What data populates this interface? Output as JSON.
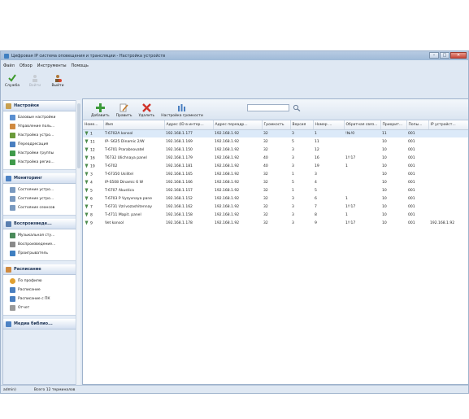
{
  "window": {
    "title": "Цифровая IP система оповещения и трансляции - Настройка устройств",
    "controls": [
      "–",
      "□",
      "✕"
    ]
  },
  "menu": [
    "Файл",
    "Обзор",
    "Инструменты",
    "Помощь"
  ],
  "main_toolbar": [
    {
      "label": "Служба",
      "icon": "service-check-icon",
      "enabled": true
    },
    {
      "label": "Войти",
      "icon": "login-icon",
      "enabled": false
    },
    {
      "label": "Выйти",
      "icon": "logout-icon",
      "enabled": true
    }
  ],
  "sidebar": {
    "groups": [
      {
        "title": "Настройки",
        "icon": "settings-icon",
        "items": [
          "Базовые настройки",
          "Управление поль...",
          "Настройка устро...",
          "Переадресация",
          "Настройки группы",
          "Настройка регио..."
        ]
      },
      {
        "title": "Мониторинг",
        "icon": "monitor-icon",
        "items": [
          "Состояние устро...",
          "Состояние устро...",
          "Состояние сеансов"
        ]
      },
      {
        "title": "Воспроизведе...",
        "icon": "playback-icon",
        "items": [
          "Музыкальная сту...",
          "Воспроизведение...",
          "Проигрыватель"
        ]
      },
      {
        "title": "Расписание",
        "icon": "schedule-icon",
        "items": [
          "По профилю",
          "Расписание",
          "Расписание с ПК",
          "Отчет"
        ]
      },
      {
        "title": "Медиа библио...",
        "icon": "media-library-icon",
        "items": []
      }
    ]
  },
  "content_toolbar": [
    {
      "label": "Добавить",
      "icon": "add-icon"
    },
    {
      "label": "Править",
      "icon": "edit-icon"
    },
    {
      "label": "Удалить",
      "icon": "delete-icon"
    },
    {
      "label": "Настройка громкости",
      "icon": "volume-settings-icon"
    }
  ],
  "table": {
    "columns": [
      "Номе...",
      "Имя",
      "Адрес (ID в интер...",
      "Адрес переадр...",
      "Громкость",
      "Версия",
      "Номер ...",
      "Обратная связ...",
      "Приорит...",
      "Попы...",
      "IP устройст..."
    ],
    "rows": [
      [
        "1",
        "T-6702A konsol",
        "192.168.1.177",
        "192.168.1.92",
        "32",
        "3",
        "1",
        "!№!0",
        "11",
        "001",
        ""
      ],
      [
        "11",
        "IP- S625 Dinamic 2/W",
        "192.168.1.169",
        "192.168.1.92",
        "32",
        "5",
        "11",
        "",
        "10",
        "001",
        ""
      ],
      [
        "12",
        "T-6701 Prarabnovatel",
        "192.168.1.150",
        "192.168.1.92",
        "32",
        "3",
        "12",
        "",
        "10",
        "001",
        ""
      ],
      [
        "16",
        "T6732 Ulichnaya panel",
        "192.168.1.179",
        "192.168.1.92",
        "40",
        "3",
        "16",
        "1!!17",
        "10",
        "001",
        ""
      ],
      [
        "19",
        "T-6702",
        "192.168.1.181",
        "192.168.1.92",
        "40",
        "3",
        "19",
        "1",
        "10",
        "001",
        ""
      ],
      [
        "3",
        "T-67350 Usilitel",
        "192.168.1.165",
        "192.168.1.92",
        "32",
        "1",
        "3",
        "",
        "10",
        "001",
        ""
      ],
      [
        "4",
        "IP-S508 Dinamic 6 W",
        "192.168.1.166",
        "192.168.1.92",
        "32",
        "5",
        "4",
        "",
        "10",
        "001",
        ""
      ],
      [
        "5",
        "T-6707 Akustica",
        "192.168.1.157",
        "192.168.1.92",
        "32",
        "1",
        "5",
        "",
        "10",
        "001",
        ""
      ],
      [
        "6",
        "T-6703 P Vyzyvnaya pane",
        "192.168.1.152",
        "192.168.1.92",
        "32",
        "3",
        "6",
        "1",
        "10",
        "001",
        ""
      ],
      [
        "7",
        "T-6731 Vzrivozashitennay",
        "192.168.1.162",
        "192.168.1.92",
        "32",
        "3",
        "7",
        "1!!17",
        "10",
        "001",
        ""
      ],
      [
        "8",
        "T-4711 Mapit. panel",
        "192.168.1.158",
        "192.168.1.92",
        "32",
        "3",
        "8",
        "1",
        "10",
        "001",
        ""
      ],
      [
        "9",
        "Vet konsol",
        "192.168.1.178",
        "192.168.1.92",
        "32",
        "3",
        "9",
        "1!!17",
        "10",
        "001",
        "192.168.1.92"
      ]
    ]
  },
  "status": {
    "user": "admin)",
    "total": "Всего 12 терминалов"
  }
}
